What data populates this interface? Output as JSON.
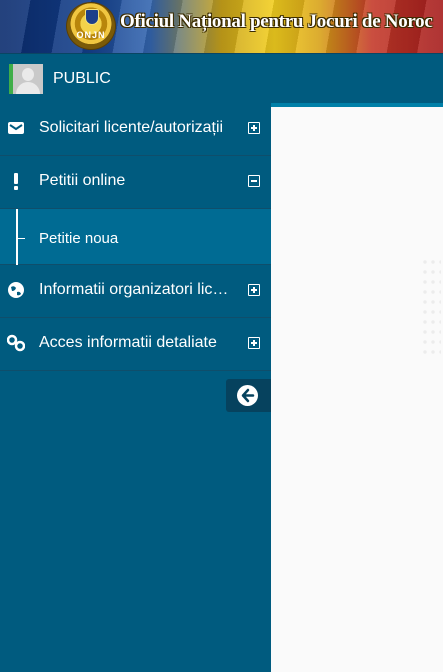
{
  "header": {
    "title": "Oficiul Național pentru Jocuri de Noroc",
    "logo_text": "ONJN"
  },
  "user": {
    "label": "PUBLIC"
  },
  "sidebar": {
    "items": [
      {
        "label": "Solicitari licente/autorizații",
        "icon": "envelope-icon",
        "expanded": false
      },
      {
        "label": "Petitii online",
        "icon": "exclamation-icon",
        "expanded": true,
        "children": [
          {
            "label": "Petitie noua"
          }
        ]
      },
      {
        "label": "Informatii organizatori licențiați",
        "icon": "globe-icon",
        "expanded": false
      },
      {
        "label": "Acces informatii detaliate",
        "icon": "link-icon",
        "expanded": false
      }
    ],
    "collapse_icon": "arrow-left-circle-icon"
  },
  "colors": {
    "sidebar_bg": "#005b7f",
    "submenu_bg": "#006b93",
    "accent": "#3fae49",
    "content_bg": "#fafafa"
  }
}
